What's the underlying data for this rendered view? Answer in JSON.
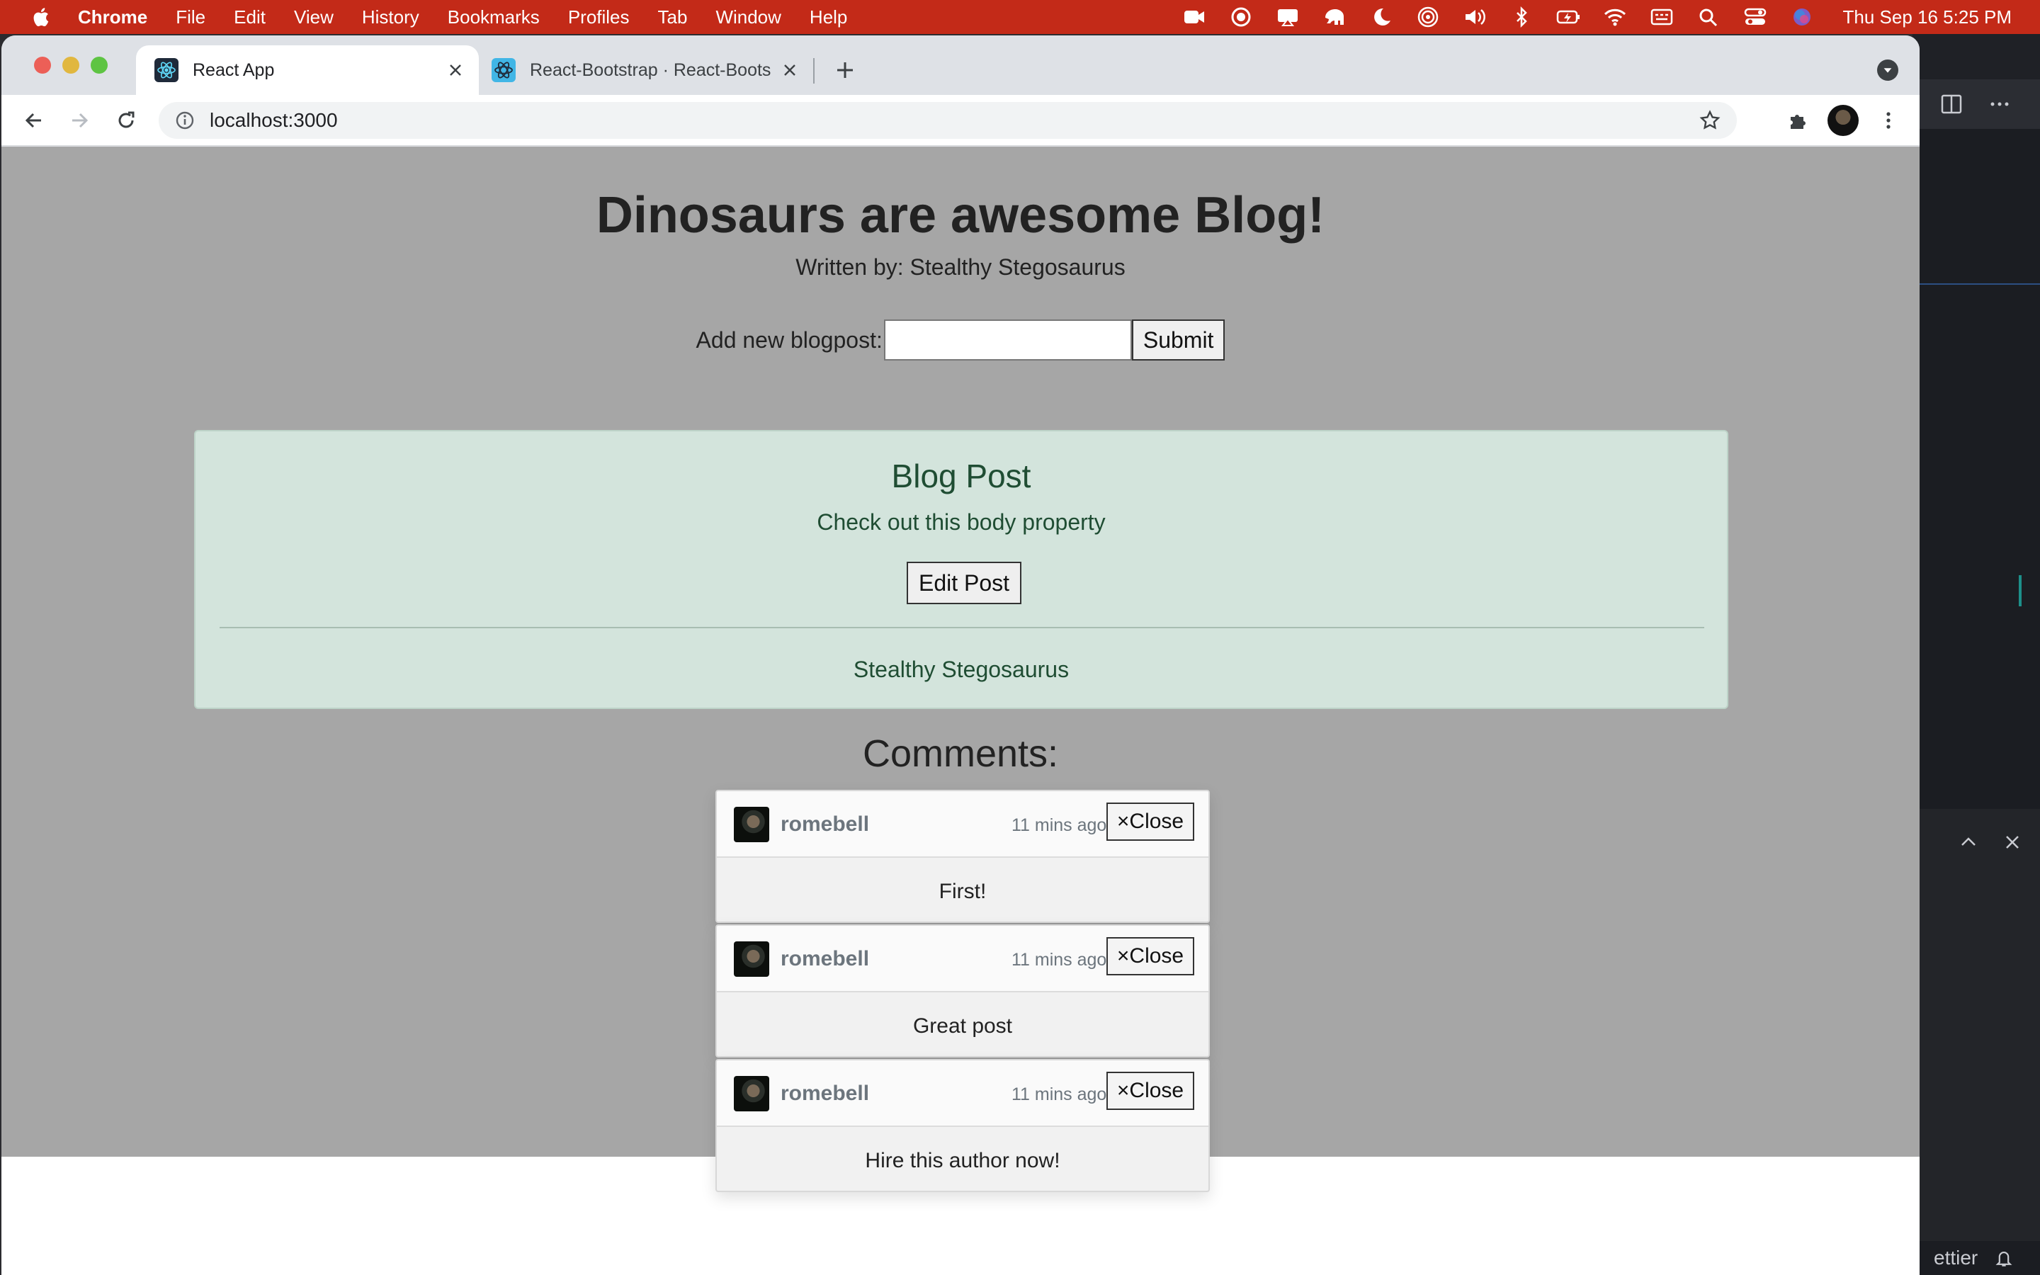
{
  "menubar": {
    "app": "Chrome",
    "items": [
      "File",
      "Edit",
      "View",
      "History",
      "Bookmarks",
      "Profiles",
      "Tab",
      "Window",
      "Help"
    ],
    "clock": "Thu Sep 16  5:25 PM",
    "status_icons": [
      "zoom-icon",
      "record-icon",
      "airplay-icon",
      "elephant-icon",
      "moon-icon",
      "airdrop-icon",
      "volume-icon",
      "bluetooth-icon",
      "battery-icon",
      "wifi-icon",
      "keyboard-icon",
      "spotlight-icon",
      "control-center-icon",
      "siri-icon"
    ]
  },
  "browser": {
    "tabs": [
      {
        "title": "React App",
        "icon": "react-icon",
        "active": true
      },
      {
        "title": "React-Bootstrap · React-Boots",
        "icon": "react-bootstrap-icon",
        "active": false
      }
    ],
    "url": "localhost:3000"
  },
  "page": {
    "title": "Dinosaurs are awesome Blog!",
    "author_line": "Written by: Stealthy Stegosaurus",
    "new_post_label": "Add new blogpost:",
    "new_post_value": "",
    "submit_label": "Submit",
    "post": {
      "title": "Blog Post",
      "body": "Check out this body property",
      "edit_label": "Edit Post",
      "footer": "Stealthy Stegosaurus"
    },
    "comments_heading": "Comments:",
    "comments": [
      {
        "user": "romebell",
        "time": "11 mins ago",
        "close_label": "×Close",
        "text": "First!"
      },
      {
        "user": "romebell",
        "time": "11 mins ago",
        "close_label": "×Close",
        "text": "Great post"
      },
      {
        "user": "romebell",
        "time": "11 mins ago",
        "close_label": "×Close",
        "text": "Hire this author now!"
      }
    ]
  },
  "editor": {
    "status_text": "ettier"
  },
  "colors": {
    "menubar": "#c32a18",
    "overlay": "#a6a6a6",
    "card_bg": "#d3e4dc",
    "card_text": "#1f4d33"
  }
}
